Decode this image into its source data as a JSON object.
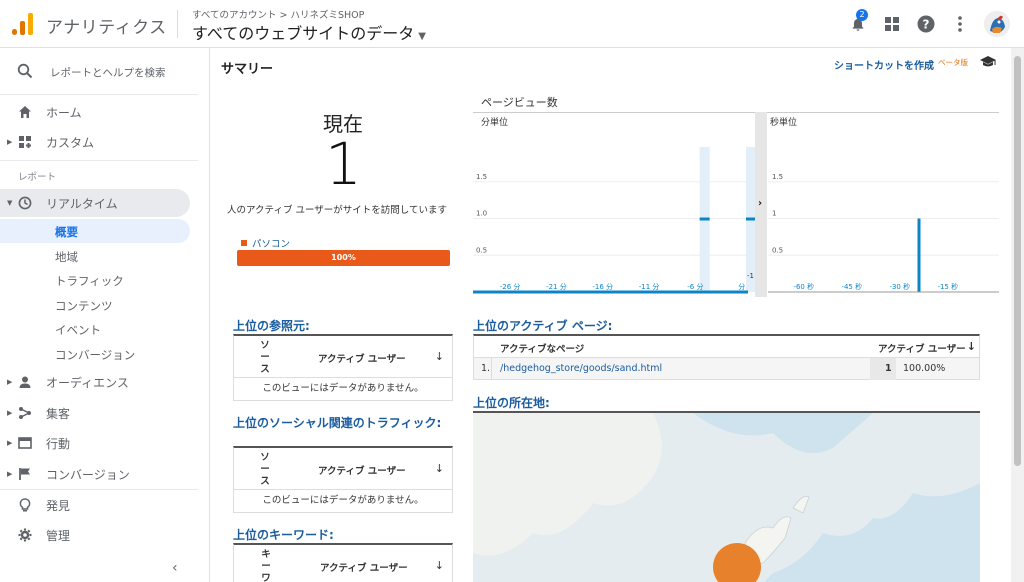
{
  "header": {
    "app_title": "アナリティクス",
    "breadcrumb": "すべてのアカウント > ハリネズミSHOP",
    "property": "すべてのウェブサイトのデータ",
    "notification_count": "2",
    "icons": [
      "bell-icon",
      "apps-icon",
      "help-icon",
      "more-vert-icon",
      "avatar"
    ]
  },
  "sidebar": {
    "search": "レポートとヘルプを検索",
    "home": "ホーム",
    "custom": "カスタム",
    "section_label": "レポート",
    "realtime": "リアルタイム",
    "realtime_sub": [
      "概要",
      "地域",
      "トラフィック",
      "コンテンツ",
      "イベント",
      "コンバージョン"
    ],
    "audience": "オーディエンス",
    "acquisition": "集客",
    "behavior": "行動",
    "conversion": "コンバージョン",
    "discover": "発見",
    "admin": "管理",
    "collapse": "‹"
  },
  "main": {
    "title": "サマリー",
    "shortcut": "ショートカットを作成",
    "beta": "ベータ版",
    "now_label": "現在",
    "now_value": "1",
    "now_desc": "人のアクティブ ユーザーがサイトを訪問しています",
    "device_label": "パソコン",
    "device_pct": "100%",
    "pageview_title": "ページビュー数",
    "referrers_title": "上位の参照元:",
    "social_title": "上位のソーシャル関連のトラフィック:",
    "keywords_title": "上位のキーワード:",
    "source_col": "ソース",
    "keyword_col": "キーワード",
    "active_users_col": "アクティブ ユーザー",
    "sort_arrow": "↓",
    "no_data": "このビューにはデータがありません。",
    "active_pages_title": "上位のアクティブ ページ:",
    "active_page_col": "アクティブなページ",
    "active_pages": [
      {
        "rank": "1.",
        "page": "/hedgehog_store/goods/sand.html",
        "users": "1",
        "pct": "100.00%"
      }
    ],
    "locations_title": "上位の所在地:"
  },
  "chart_data": [
    {
      "type": "bar",
      "title": "ページビュー数",
      "subtitle": "分単位",
      "x": [
        "-26 分",
        "-21 分",
        "-16 分",
        "-11 分",
        "-6 分",
        "-1 分"
      ],
      "values_note_ticks": [
        "1.5",
        "1.0",
        "0.5"
      ],
      "ylim": [
        0,
        2
      ],
      "bars": [
        {
          "x_minutes": -5,
          "value": 1
        },
        {
          "x_minutes": 0,
          "value": 1
        }
      ],
      "color": "#0c85c8"
    },
    {
      "type": "bar",
      "subtitle": "秒単位",
      "x": [
        "-60 秒",
        "-45 秒",
        "-30 秒",
        "-15 秒"
      ],
      "values_note_ticks": [
        "1.5",
        "1",
        "0.5"
      ],
      "ylim": [
        0,
        2
      ],
      "bars": [
        {
          "x_seconds": -25,
          "value": 1
        }
      ],
      "color": "#0c85c8"
    }
  ]
}
